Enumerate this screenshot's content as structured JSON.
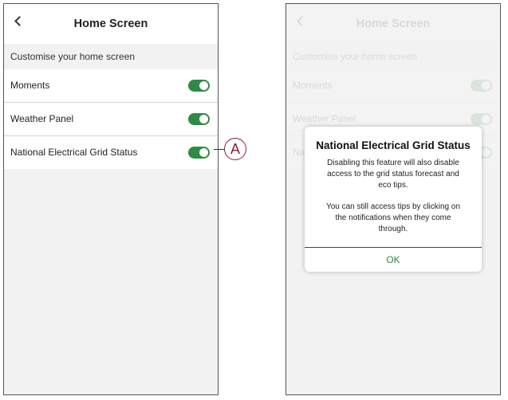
{
  "left_screen": {
    "header": {
      "title": "Home Screen"
    },
    "section_label": "Customise your home screen",
    "settings": [
      {
        "label": "Moments",
        "enabled": true
      },
      {
        "label": "Weather Panel",
        "enabled": true
      },
      {
        "label": "National Electrical Grid Status",
        "enabled": true
      }
    ],
    "callout": "A"
  },
  "right_screen": {
    "dialog": {
      "title": "National Electrical Grid Status",
      "body_1": "Disabling this feature will also disable access to the grid status forecast and eco tips.",
      "body_2": "You can still access tips by clicking on the notifications when they come through.",
      "ok_label": "OK"
    }
  },
  "colors": {
    "toggle_on": "#2e8b43",
    "callout": "#8b2030",
    "ok_text": "#2e8b43"
  }
}
